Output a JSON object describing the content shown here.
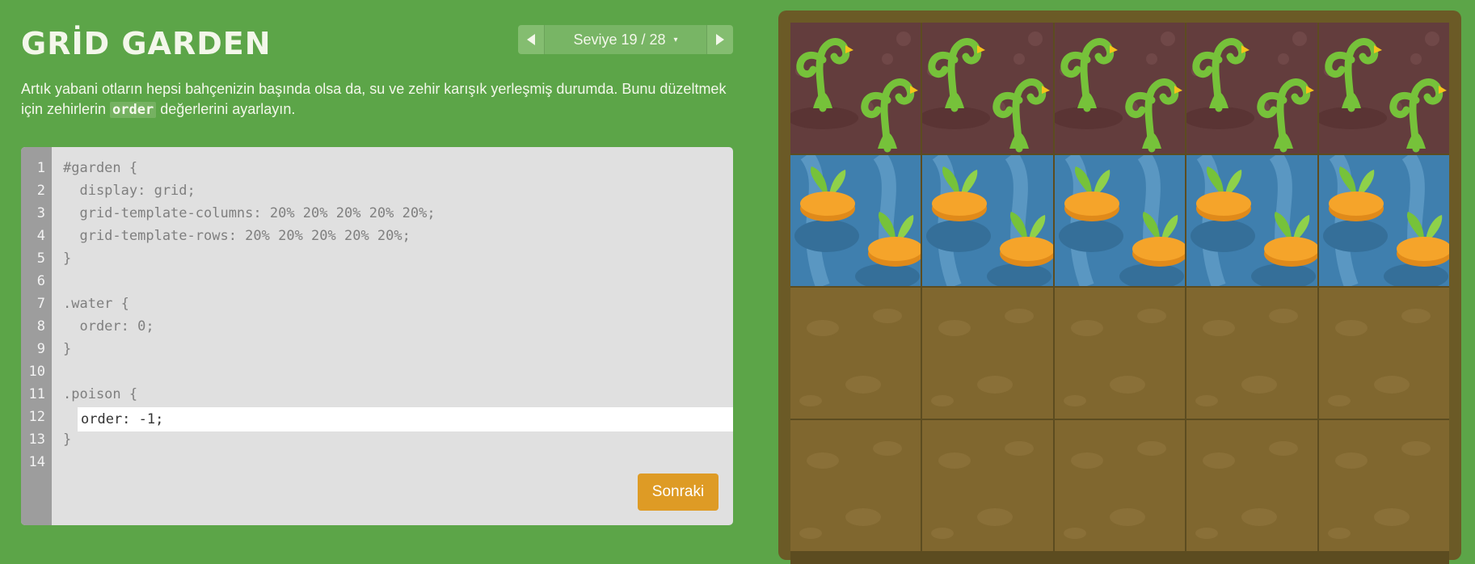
{
  "app": {
    "title": "GRİD GARDEN"
  },
  "level_nav": {
    "prev_icon": "triangle-left-icon",
    "next_icon": "triangle-right-icon",
    "label": "Seviye 19 / 28",
    "caret": "▾"
  },
  "instructions": {
    "part1": "Artık yabani otların hepsi bahçenizin başında olsa da, su ve zehir karışık yerleşmiş durumda. Bunu düzeltmek için zehirlerin ",
    "code": "order",
    "part2": " değerlerini ayarlayın."
  },
  "editor": {
    "line_numbers": [
      "1",
      "2",
      "3",
      "4",
      "5",
      "6",
      "7",
      "8",
      "9",
      "10",
      "11",
      "12",
      "13",
      "14"
    ],
    "lines": [
      "#garden {",
      "  display: grid;",
      "  grid-template-columns: 20% 20% 20% 20% 20%;",
      "  grid-template-rows: 20% 20% 20% 20% 20%;",
      "}",
      "",
      ".water {",
      "  order: 0;",
      "}",
      "",
      ".poison {",
      "",
      "}",
      ""
    ],
    "input_value": "order: -1;",
    "next_button_label": "Sonraki"
  },
  "garden": {
    "rows": [
      [
        "poison",
        "poison",
        "poison",
        "poison",
        "poison"
      ],
      [
        "water",
        "water",
        "water",
        "water",
        "water"
      ],
      [
        "soil",
        "soil",
        "soil",
        "soil",
        "soil"
      ],
      [
        "soil",
        "soil",
        "soil",
        "soil",
        "soil"
      ]
    ],
    "colors": {
      "poison": "#633d3d",
      "water": "#3f7fae",
      "soil": "#80672f",
      "weed": "#76c23a",
      "carrot": "#f5a42a"
    }
  }
}
